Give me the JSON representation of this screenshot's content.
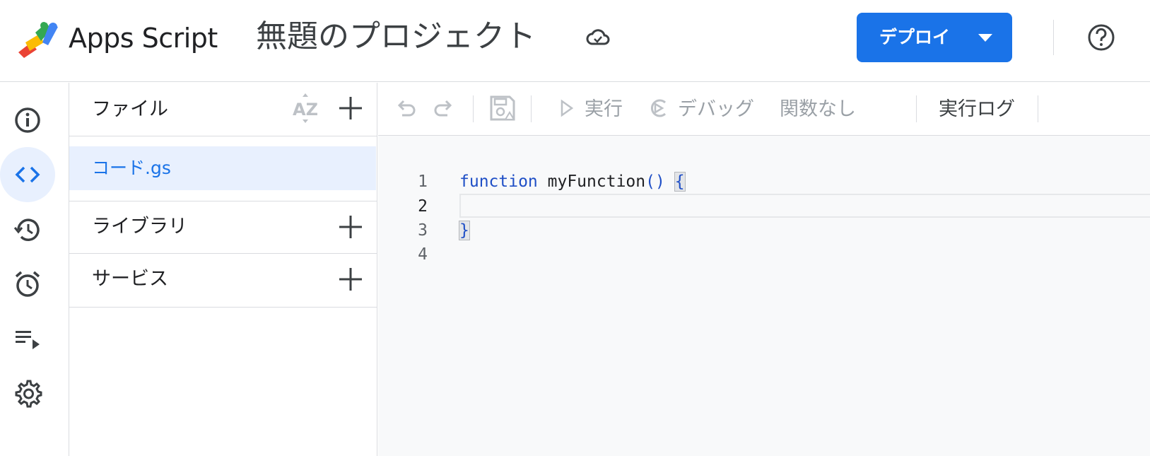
{
  "header": {
    "app_name": "Apps Script",
    "project_title": "無題のプロジェクト",
    "deploy_label": "デプロイ"
  },
  "files_panel": {
    "files_label": "ファイル",
    "files": [
      "コード.gs"
    ],
    "libraries_label": "ライブラリ",
    "services_label": "サービス"
  },
  "toolbar": {
    "run_label": "実行",
    "debug_label": "デバッグ",
    "function_select": "関数なし",
    "execution_log_label": "実行ログ"
  },
  "editor": {
    "line_numbers": [
      "1",
      "2",
      "3",
      "4"
    ],
    "code": {
      "keyword": "function",
      "function_name": "myFunction",
      "parens": "()",
      "open_brace": "{",
      "close_brace": "}"
    }
  },
  "colors": {
    "accent": "#1a73e8",
    "active_bg": "#e8f0fe",
    "editor_bg": "#f8f9fa"
  },
  "icons": {
    "nav": [
      "info-icon",
      "code-icon",
      "history-icon",
      "alarm-icon",
      "executions-icon",
      "gear-icon"
    ]
  }
}
